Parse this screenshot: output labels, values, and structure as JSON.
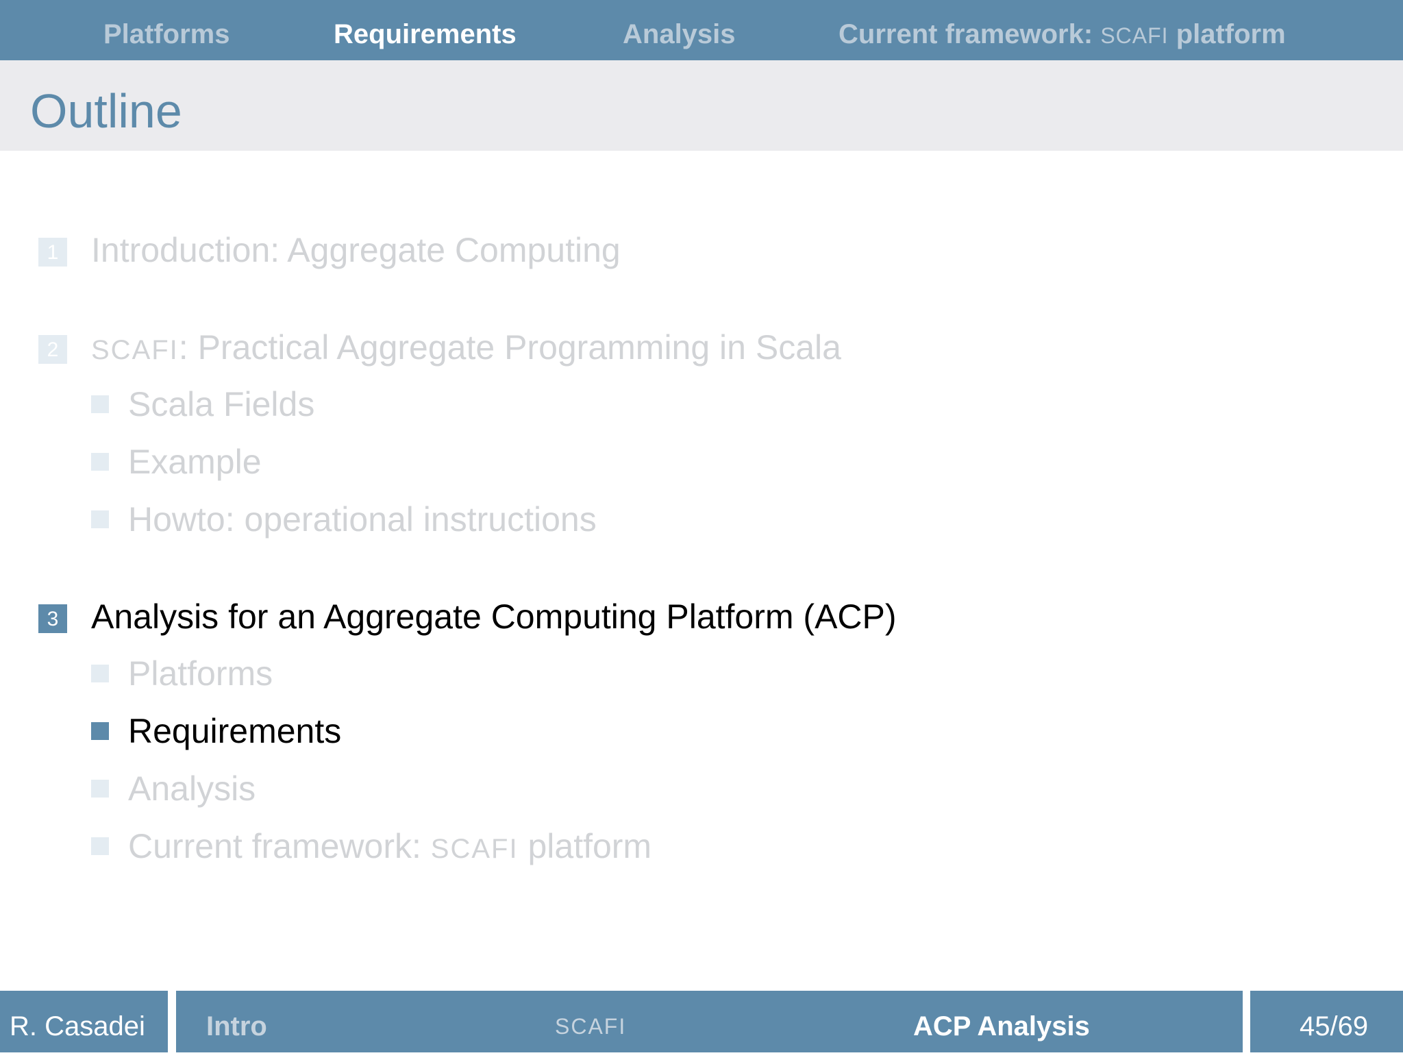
{
  "nav": {
    "items": [
      {
        "label": "Platforms"
      },
      {
        "label": "Requirements"
      },
      {
        "label": "Analysis"
      },
      {
        "label_main": "Current framework:",
        "label_sc": "SCAFI",
        "label_tail": "platform"
      }
    ],
    "active_index": 1
  },
  "title": "Outline",
  "sections": [
    {
      "number": "1",
      "label": "Introduction: Aggregate Computing",
      "state": "faded"
    },
    {
      "number": "2",
      "label_sc": "SCAFI",
      "label_rest": ": Practical Aggregate Programming in Scala",
      "state": "faded",
      "subitems": [
        {
          "label": "Scala Fields"
        },
        {
          "label": "Example"
        },
        {
          "label": "Howto: operational instructions"
        }
      ]
    },
    {
      "number": "3",
      "label": "Analysis for an Aggregate Computing Platform (ACP)",
      "state": "active",
      "subitems": [
        {
          "label": "Platforms",
          "state": "faded"
        },
        {
          "label": "Requirements",
          "state": "active"
        },
        {
          "label": "Analysis",
          "state": "faded"
        },
        {
          "label_main": "Current framework: ",
          "label_sc": "SCAFI",
          "label_tail": " platform",
          "state": "faded"
        }
      ]
    }
  ],
  "footer": {
    "author": "R. Casadei",
    "section_intro": "Intro",
    "section_scafi": "SCAFI",
    "section_acp": "ACP Analysis",
    "page": "45/69"
  },
  "colors": {
    "accent": "#5d8aaa",
    "title_bar": "#ebebee",
    "faded_text": "#d1d3d6",
    "faded_bullet": "#e4ecf2",
    "nav_inactive": "#b9cad8"
  }
}
